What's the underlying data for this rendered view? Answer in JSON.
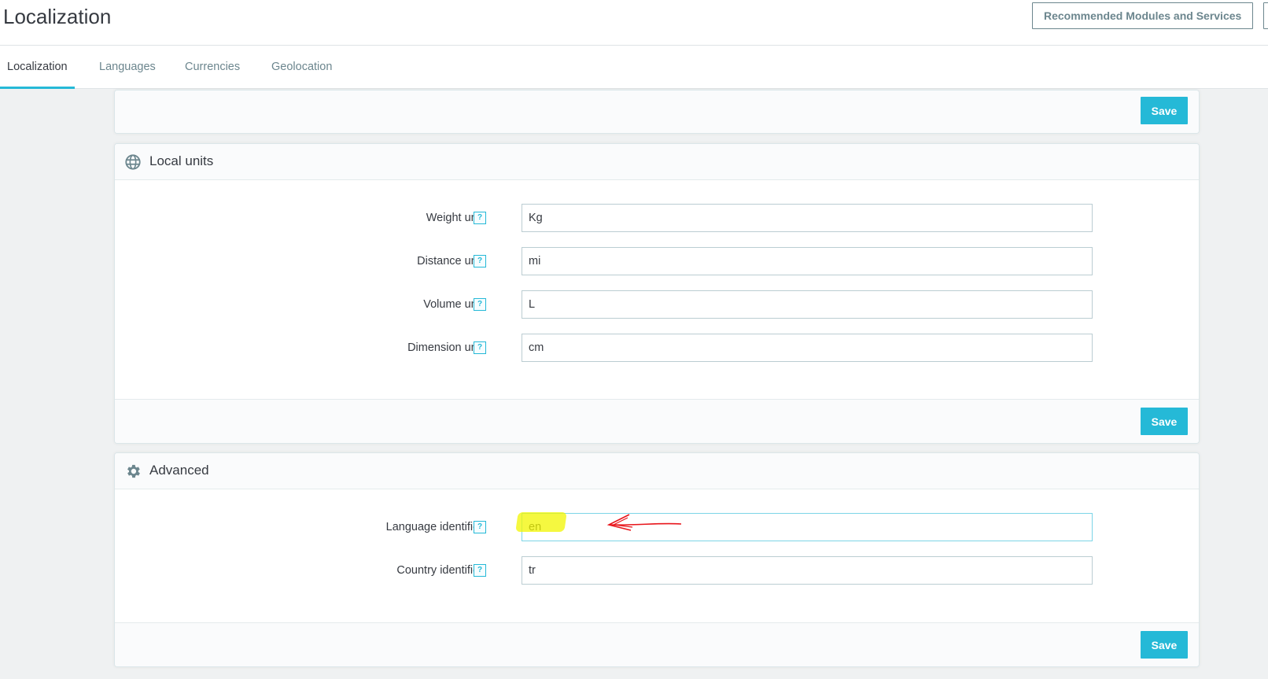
{
  "header": {
    "title": "Localization",
    "recommended_label": "Recommended Modules and Services"
  },
  "tabs": [
    {
      "label": "Localization",
      "active": true
    },
    {
      "label": "Languages",
      "active": false
    },
    {
      "label": "Currencies",
      "active": false
    },
    {
      "label": "Geolocation",
      "active": false
    }
  ],
  "top_panel": {
    "save_label": "Save"
  },
  "local_units": {
    "title": "Local units",
    "icon": "globe-icon",
    "fields": [
      {
        "label": "Weight unit",
        "value": "Kg"
      },
      {
        "label": "Distance unit",
        "value": "mi"
      },
      {
        "label": "Volume unit",
        "value": "L"
      },
      {
        "label": "Dimension unit",
        "value": "cm"
      }
    ],
    "save_label": "Save"
  },
  "advanced": {
    "title": "Advanced",
    "icon": "gear-icon",
    "fields": [
      {
        "label": "Language identifier",
        "value": "en"
      },
      {
        "label": "Country identifier",
        "value": "tr"
      }
    ],
    "save_label": "Save"
  },
  "help_glyph": "?",
  "colors": {
    "accent": "#25b9d7",
    "background": "#eff1f2",
    "highlight": "#f2f500",
    "annotation": "#e8151b"
  }
}
